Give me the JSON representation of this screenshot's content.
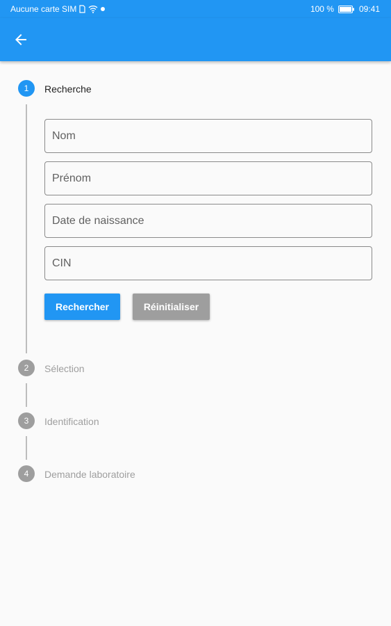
{
  "status_bar": {
    "carrier": "Aucune carte SIM",
    "battery": "100 %",
    "time": "09:41"
  },
  "app_bar": {
    "back_icon": "arrow-back-icon"
  },
  "stepper": {
    "steps": [
      {
        "number": "1",
        "title": "Recherche",
        "state": "active"
      },
      {
        "number": "2",
        "title": "Sélection",
        "state": "inactive"
      },
      {
        "number": "3",
        "title": "Identification",
        "state": "inactive"
      },
      {
        "number": "4",
        "title": "Demande laboratoire",
        "state": "inactive"
      }
    ]
  },
  "form": {
    "fields": [
      {
        "placeholder": "Nom",
        "value": ""
      },
      {
        "placeholder": "Prénom",
        "value": ""
      },
      {
        "placeholder": "Date de naissance",
        "value": ""
      },
      {
        "placeholder": "CIN",
        "value": ""
      }
    ],
    "search_label": "Rechercher",
    "reset_label": "Réinitialiser"
  },
  "colors": {
    "primary": "#2196f3",
    "inactive": "#9e9e9e",
    "background": "#fafafa"
  }
}
